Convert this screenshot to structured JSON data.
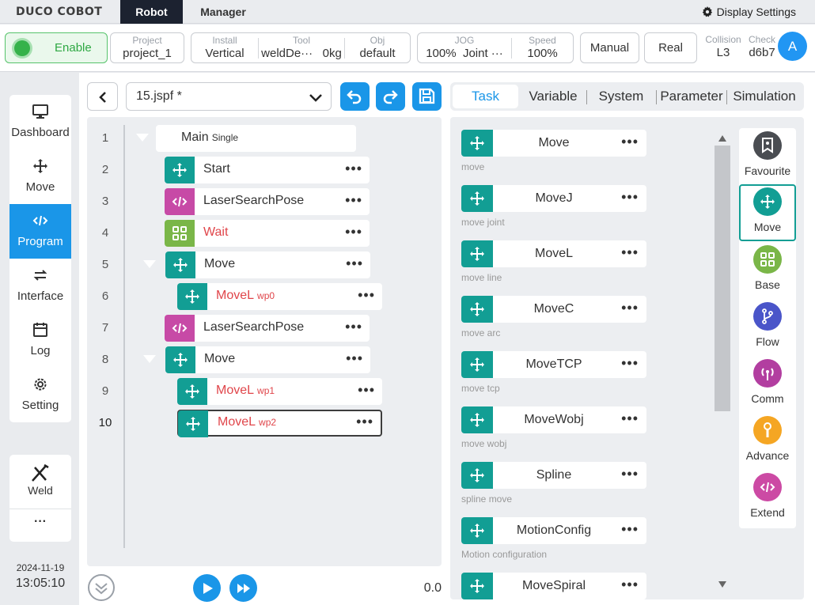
{
  "app": {
    "logo": "DUCO COBOT",
    "tabs": [
      "Robot",
      "Manager"
    ],
    "settings_label": "Display Settings"
  },
  "status": {
    "enable": "Enable",
    "project": {
      "label": "Project",
      "value": "project_1"
    },
    "install": {
      "label": "Install",
      "value": "Vertical"
    },
    "tool": {
      "label": "Tool",
      "value": "weldDe···",
      "weight": "0kg"
    },
    "obj": {
      "label": "Obj",
      "value": "default"
    },
    "jog": {
      "label": "JOG",
      "value": "100%",
      "mode": "Joint ···"
    },
    "speed": {
      "label": "Speed",
      "value": "100%"
    },
    "manual": "Manual",
    "real": "Real",
    "collision": {
      "label": "Collision",
      "value": "L3"
    },
    "check": {
      "label": "Check",
      "value": "d6b7"
    },
    "avatar": "A"
  },
  "sidebar": {
    "items": [
      {
        "label": "Dashboard",
        "icon": "monitor-icon"
      },
      {
        "label": "Move",
        "icon": "move-arrows-icon"
      },
      {
        "label": "Program",
        "icon": "code-icon",
        "active": true
      },
      {
        "label": "Interface",
        "icon": "swap-icon"
      },
      {
        "label": "Log",
        "icon": "calendar-icon"
      },
      {
        "label": "Setting",
        "icon": "gear-icon"
      }
    ],
    "weld": "Weld",
    "more": "···",
    "date": "2024-11-19",
    "time": "13:05:10"
  },
  "program": {
    "file": "15.jspf *",
    "speed_value": "0.0",
    "lines": [
      {
        "n": "1",
        "name": "Main",
        "suffix": "Single"
      },
      {
        "n": "2",
        "name": "Start",
        "suffix": ""
      },
      {
        "n": "3",
        "name": "LaserSearchPose",
        "suffix": ""
      },
      {
        "n": "4",
        "name": "Wait",
        "suffix": ""
      },
      {
        "n": "5",
        "name": "Move",
        "suffix": ""
      },
      {
        "n": "6",
        "name": "MoveL",
        "suffix": "wp0"
      },
      {
        "n": "7",
        "name": "LaserSearchPose",
        "suffix": ""
      },
      {
        "n": "8",
        "name": "Move",
        "suffix": ""
      },
      {
        "n": "9",
        "name": "MoveL",
        "suffix": "wp1"
      },
      {
        "n": "10",
        "name": "MoveL",
        "suffix": "wp2"
      }
    ],
    "dots": "•••"
  },
  "right": {
    "tabs": [
      "Task",
      "Variable",
      "System",
      "Parameter",
      "Simulation"
    ],
    "commands": [
      {
        "name": "Move",
        "desc": "move"
      },
      {
        "name": "MoveJ",
        "desc": "move joint"
      },
      {
        "name": "MoveL",
        "desc": "move line"
      },
      {
        "name": "MoveC",
        "desc": "move arc"
      },
      {
        "name": "MoveTCP",
        "desc": "move tcp"
      },
      {
        "name": "MoveWobj",
        "desc": "move wobj"
      },
      {
        "name": "Spline",
        "desc": "spline move"
      },
      {
        "name": "MotionConfig",
        "desc": "Motion configuration"
      },
      {
        "name": "MoveSpiral",
        "desc": ""
      }
    ],
    "categories": [
      {
        "label": "Favourite",
        "color": "#4a4d52"
      },
      {
        "label": "Move",
        "color": "#129e94"
      },
      {
        "label": "Base",
        "color": "#7ab648"
      },
      {
        "label": "Flow",
        "color": "#4a55c9"
      },
      {
        "label": "Comm",
        "color": "#b23ea0"
      },
      {
        "label": "Advance",
        "color": "#f5a623"
      },
      {
        "label": "Extend",
        "color": "#cc4aa4"
      }
    ]
  },
  "colors": {
    "accent": "#1a96e8",
    "teal": "#129e94",
    "purple": "#c74aa6",
    "green": "#7ab648",
    "red_text": "#e0454a"
  }
}
